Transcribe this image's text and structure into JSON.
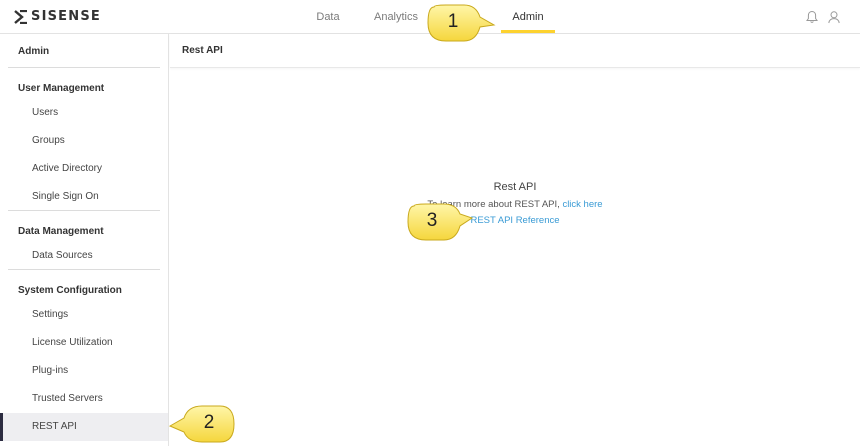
{
  "brand": {
    "name": "SISENSE"
  },
  "topnav": {
    "tabs": [
      {
        "label": "Data"
      },
      {
        "label": "Analytics"
      },
      {
        "label": "Admin"
      }
    ],
    "active_tab": "Admin",
    "accent_color": "#fdd22f"
  },
  "sidebar": {
    "title": "Admin",
    "sections": [
      {
        "title": "User Management",
        "items": [
          "Users",
          "Groups",
          "Active Directory",
          "Single Sign On"
        ]
      },
      {
        "title": "Data Management",
        "items": [
          "Data Sources"
        ]
      },
      {
        "title": "System Configuration",
        "items": [
          "Settings",
          "License Utilization",
          "Plug-ins",
          "Trusted Servers",
          "REST API"
        ]
      }
    ],
    "selected_item": "REST API"
  },
  "main": {
    "header_title": "Rest API",
    "content_title": "Rest API",
    "learn_text": "To learn more about REST API,",
    "learn_link": "click here",
    "reference_link": "REST API Reference",
    "link_color": "#3a9bd5"
  },
  "callouts": [
    {
      "number": "1"
    },
    {
      "number": "2"
    },
    {
      "number": "3"
    }
  ],
  "icons": {
    "notifications": "bell-icon",
    "user": "user-icon"
  }
}
